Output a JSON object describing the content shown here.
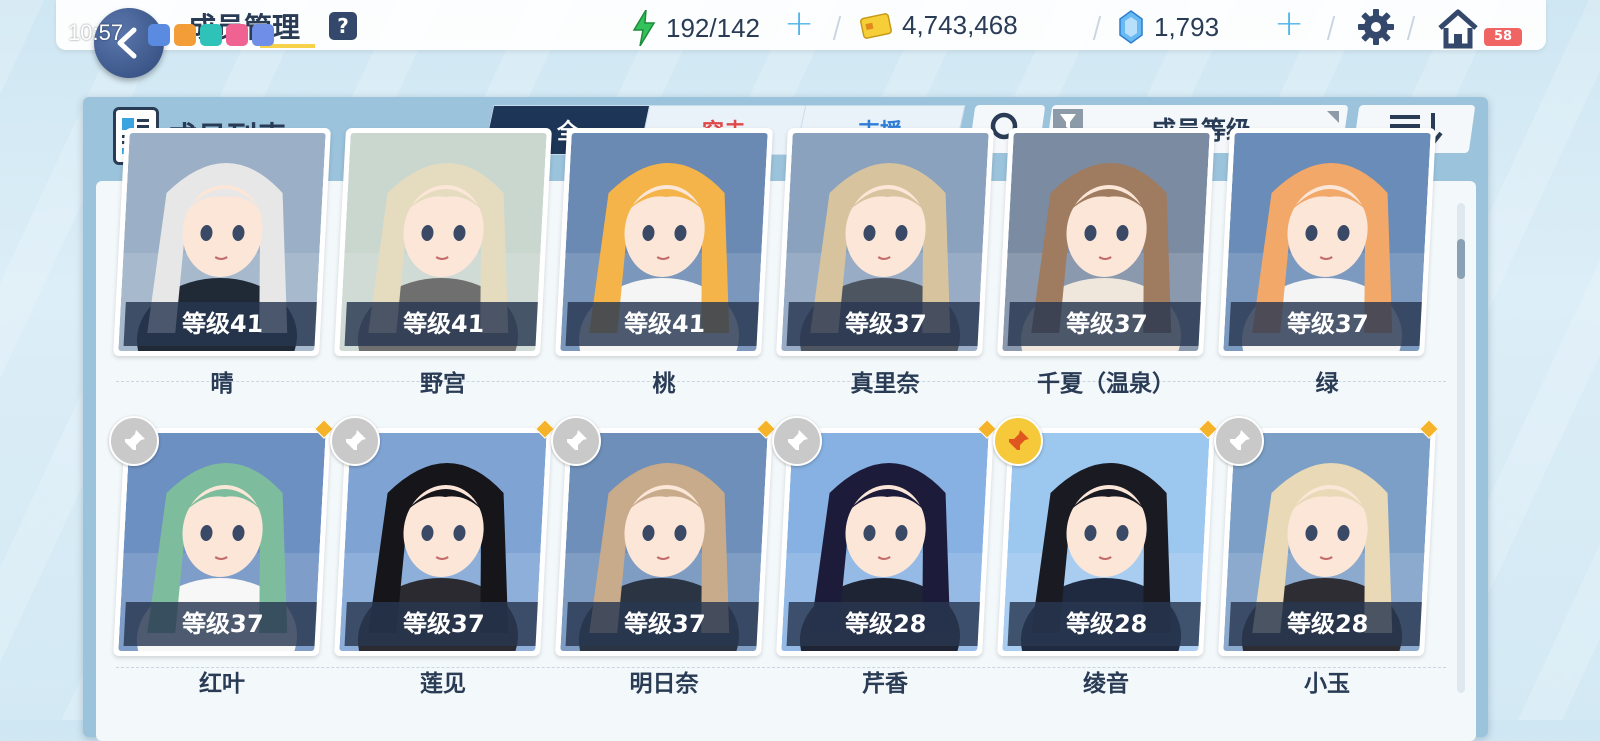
{
  "status": {
    "time": "10:57",
    "battery": "58"
  },
  "header": {
    "title": "成员管理",
    "help": "?",
    "ap": "192/142",
    "credits": "4,743,468",
    "gems": "1,793"
  },
  "panel": {
    "title": "成员列表",
    "tabs": [
      "全",
      "突击",
      "支援"
    ],
    "filter_label": "成员等级"
  },
  "students": [
    {
      "level": "等级41",
      "name": "晴",
      "hair": "#e7e7e7",
      "bg": "#9bb0c6",
      "coat": "#1f2a36"
    },
    {
      "level": "等级41",
      "name": "野宫",
      "hair": "#e5dcc0",
      "bg": "#c9d7cf",
      "coat": "#6f6f6f"
    },
    {
      "level": "等级41",
      "name": "桃",
      "hair": "#f4b44a",
      "bg": "#6a89b3",
      "coat": "#f5f5f5"
    },
    {
      "level": "等级37",
      "name": "真里奈",
      "hair": "#d7c49e",
      "bg": "#8aa2be",
      "coat": "#4d5660"
    },
    {
      "level": "等级37",
      "name": "千夏（温泉）",
      "hair": "#9f7b5f",
      "bg": "#7a8ba2",
      "coat": "#efe7dc"
    },
    {
      "level": "等级37",
      "name": "绿",
      "hair": "#f2a868",
      "bg": "#6a8cb8",
      "coat": "#f4f4f4"
    },
    {
      "level": "等级37",
      "name": "红叶",
      "hair": "#7dbd9d",
      "bg": "#6d90c2",
      "coat": "#f7f7f7",
      "pinned": false
    },
    {
      "level": "等级37",
      "name": "莲见",
      "hair": "#15151a",
      "bg": "#7fa4d4",
      "coat": "#2a2a30",
      "pinned": false
    },
    {
      "level": "等级37",
      "name": "明日奈",
      "hair": "#c8ab8a",
      "bg": "#6e8fba",
      "coat": "#2b3442",
      "pinned": false
    },
    {
      "level": "等级28",
      "name": "芹香",
      "hair": "#1d1b3a",
      "bg": "#86b1e2",
      "coat": "#1e2433",
      "pinned": false
    },
    {
      "level": "等级28",
      "name": "绫音",
      "hair": "#1a1a22",
      "bg": "#9cc7ef",
      "coat": "#1f2940",
      "pinned": true
    },
    {
      "level": "等级28",
      "name": "小玉",
      "hair": "#e9d9b6",
      "bg": "#7b9fc6",
      "coat": "#2d2d33",
      "pinned": false
    }
  ]
}
